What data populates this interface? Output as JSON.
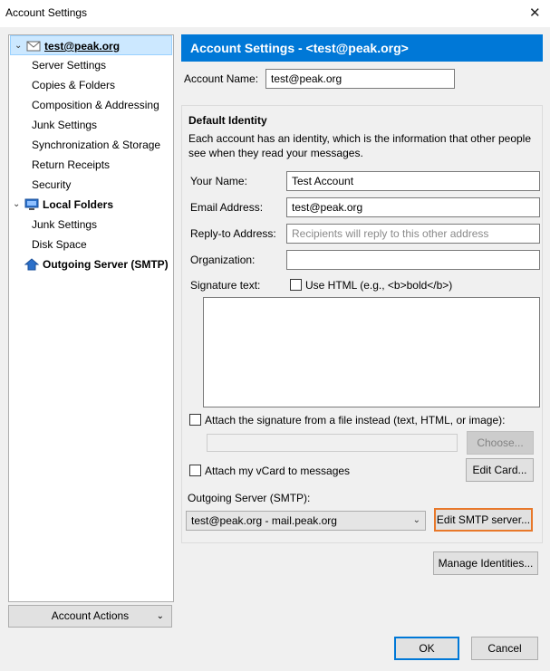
{
  "window": {
    "title": "Account Settings",
    "close_glyph": "✕"
  },
  "tree": {
    "items": [
      {
        "label": "test@peak.org",
        "icon": "email-account-icon"
      },
      {
        "label": "Server Settings"
      },
      {
        "label": "Copies & Folders"
      },
      {
        "label": "Composition & Addressing"
      },
      {
        "label": "Junk Settings"
      },
      {
        "label": "Synchronization & Storage"
      },
      {
        "label": "Return Receipts"
      },
      {
        "label": "Security"
      },
      {
        "label": "Local Folders",
        "icon": "local-folders-icon"
      },
      {
        "label": "Junk Settings"
      },
      {
        "label": "Disk Space"
      },
      {
        "label": "Outgoing Server (SMTP)",
        "icon": "outgoing-server-icon"
      }
    ],
    "twisty": "⌄"
  },
  "account_actions": {
    "label": "Account Actions",
    "chevron": "⌄"
  },
  "header": {
    "title": "Account Settings - <test@peak.org>"
  },
  "account_name": {
    "label": "Account Name:",
    "value": "test@peak.org"
  },
  "identity": {
    "title": "Default Identity",
    "description": "Each account has an identity, which is the information that other people see when they read your messages.",
    "your_name": {
      "label": "Your Name:",
      "value": "Test Account"
    },
    "email": {
      "label": "Email Address:",
      "value": "test@peak.org"
    },
    "reply_to": {
      "label": "Reply-to Address:",
      "placeholder": "Recipients will reply to this other address"
    },
    "organization": {
      "label": "Organization:",
      "value": ""
    },
    "signature": {
      "label": "Signature text:",
      "use_html_label": "Use HTML (e.g., <b>bold</b>)"
    },
    "attach_file": {
      "label": "Attach the signature from a file instead (text, HTML, or image):",
      "choose_button": "Choose..."
    },
    "attach_vcard": {
      "label": "Attach my vCard to messages",
      "edit_card_button": "Edit Card..."
    },
    "smtp": {
      "label": "Outgoing Server (SMTP):",
      "selected": "test@peak.org - mail.peak.org",
      "edit_button": "Edit SMTP server..."
    }
  },
  "manage_identities_button": "Manage Identities...",
  "footer": {
    "ok": "OK",
    "cancel": "Cancel"
  },
  "colors": {
    "accent": "#0078d7",
    "highlight_border": "#e8782a",
    "selection": "#cce8ff"
  }
}
